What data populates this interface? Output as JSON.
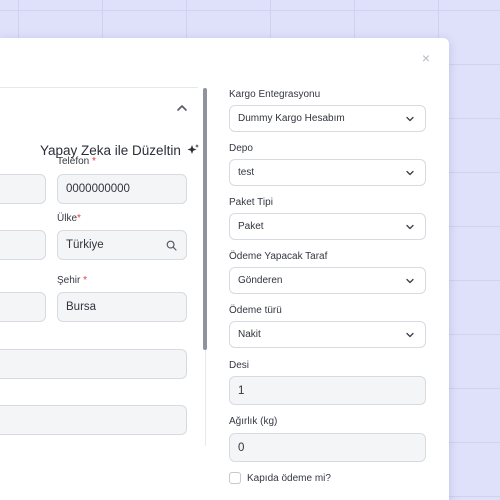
{
  "modal": {
    "close_glyph": "×",
    "ai_button_label": "Yapay Zeka ile Düzeltin",
    "left_form": {
      "phone": {
        "label": "Telefon",
        "required": "*",
        "value": "0000000000"
      },
      "country": {
        "label": "Ülke",
        "required": "*",
        "value": "Türkiye",
        "icon": "search-icon"
      },
      "city": {
        "label": "Şehir",
        "required": "*",
        "value": "Bursa"
      }
    },
    "right_form": {
      "cargo_integration": {
        "label": "Kargo Entegrasyonu",
        "value": "Dummy Kargo Hesabım"
      },
      "warehouse": {
        "label": "Depo",
        "value": "test"
      },
      "package_type": {
        "label": "Paket Tipi",
        "value": "Paket"
      },
      "payer": {
        "label": "Ödeme Yapacak Taraf",
        "value": "Gönderen"
      },
      "payment_type": {
        "label": "Ödeme türü",
        "value": "Nakit"
      },
      "desi": {
        "label": "Desi",
        "value": "1"
      },
      "weight": {
        "label": "Ağırlık (kg)",
        "value": "0"
      },
      "cash_on_delivery": {
        "label": "Kapıda ödeme mi?",
        "checked": false
      }
    }
  },
  "colors": {
    "background": "#dfe1fb",
    "grid_lines": "#cfd3f3",
    "required": "#e23c3c",
    "input_bg": "#f4f5f7",
    "border": "#d7dae0"
  }
}
